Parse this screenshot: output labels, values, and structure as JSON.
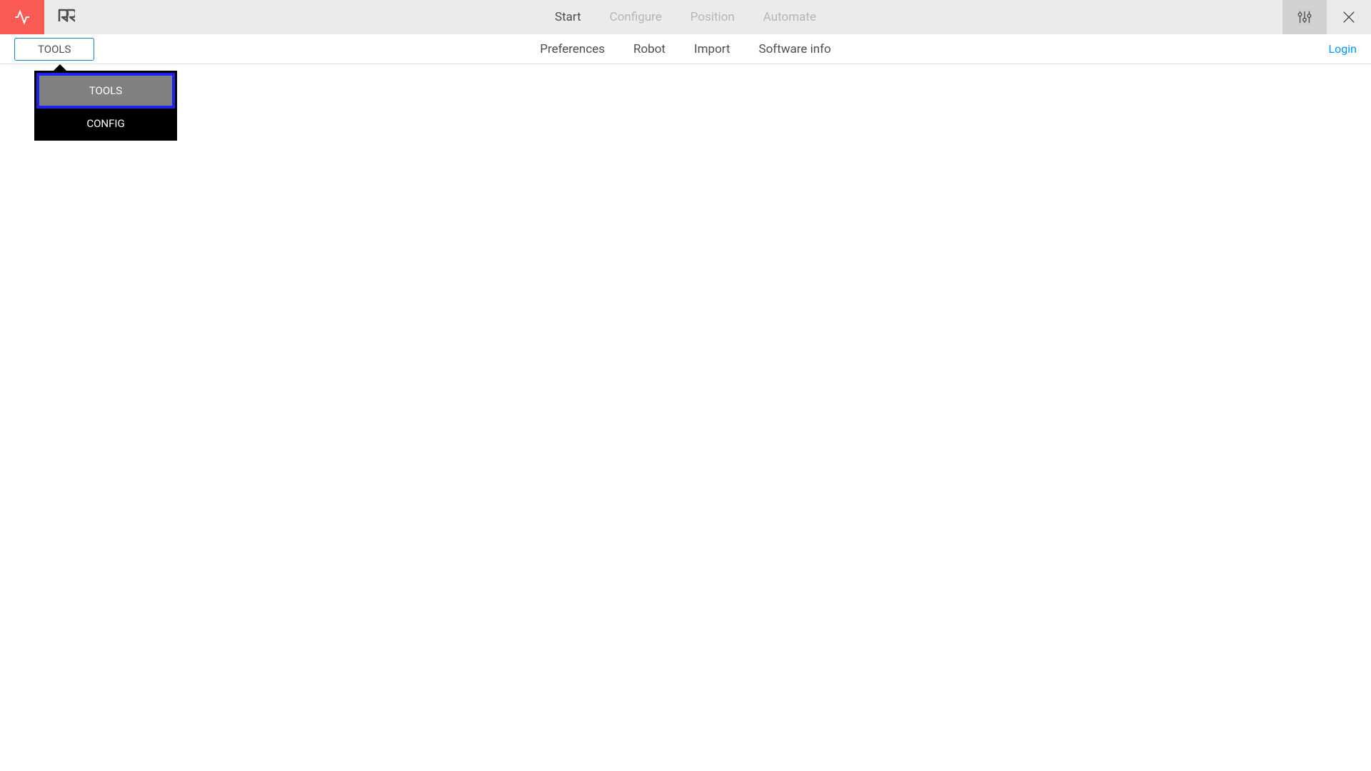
{
  "topNav": {
    "items": [
      {
        "label": "Start",
        "active": true
      },
      {
        "label": "Configure",
        "active": false
      },
      {
        "label": "Position",
        "active": false
      },
      {
        "label": "Automate",
        "active": false
      }
    ]
  },
  "subBar": {
    "toolsButton": "TOOLS",
    "items": [
      {
        "label": "Preferences"
      },
      {
        "label": "Robot"
      },
      {
        "label": "Import"
      },
      {
        "label": "Software info"
      }
    ],
    "loginLink": "Login"
  },
  "dropdown": {
    "items": [
      {
        "label": "TOOLS",
        "selected": true
      },
      {
        "label": "CONFIG",
        "selected": false
      }
    ]
  }
}
